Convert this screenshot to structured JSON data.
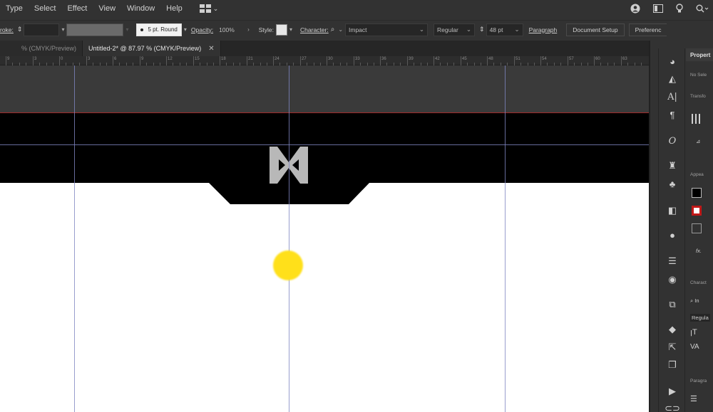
{
  "menu": {
    "items": [
      "Type",
      "Select",
      "Effect",
      "View",
      "Window",
      "Help"
    ]
  },
  "control_bar": {
    "stroke_label": "roke:",
    "brush_label": "5 pt. Round",
    "opacity_label": "Opacity:",
    "opacity_value": "100%",
    "style_label": "Style:",
    "character_label": "Character:",
    "font_family": "Impact",
    "font_style": "Regular",
    "font_size": "48 pt",
    "paragraph_label": "Paragraph",
    "document_setup_label": "Document Setup",
    "preferences_label": "Preferenc"
  },
  "tabs": [
    {
      "label": "% (CMYK/Preview)",
      "active": false
    },
    {
      "label": "Untitled-2* @ 87.97 % (CMYK/Preview)",
      "active": true
    }
  ],
  "ruler": {
    "labels": [
      "9",
      "3",
      "0",
      "3",
      "6",
      "9",
      "12",
      "15",
      "18",
      "21",
      "24",
      "27",
      "30",
      "33",
      "36",
      "39",
      "42",
      "45",
      "48",
      "51",
      "54",
      "57",
      "60",
      "63"
    ]
  },
  "canvas": {
    "header_color": "#000000",
    "logo_color": "#b8b8b8",
    "cursor_dot_color": "#ffe01a",
    "guide_color": "#7f86c2",
    "bleed_color": "#a02a2a"
  },
  "properties_panel": {
    "title": "Propert",
    "no_selection": "No Sele",
    "transform": "Transfo",
    "appearance": "Appea",
    "fx": "fx.",
    "character": "Charact",
    "font_prefix": "In",
    "font_style": "Regula",
    "paragraph": "Paragra"
  }
}
